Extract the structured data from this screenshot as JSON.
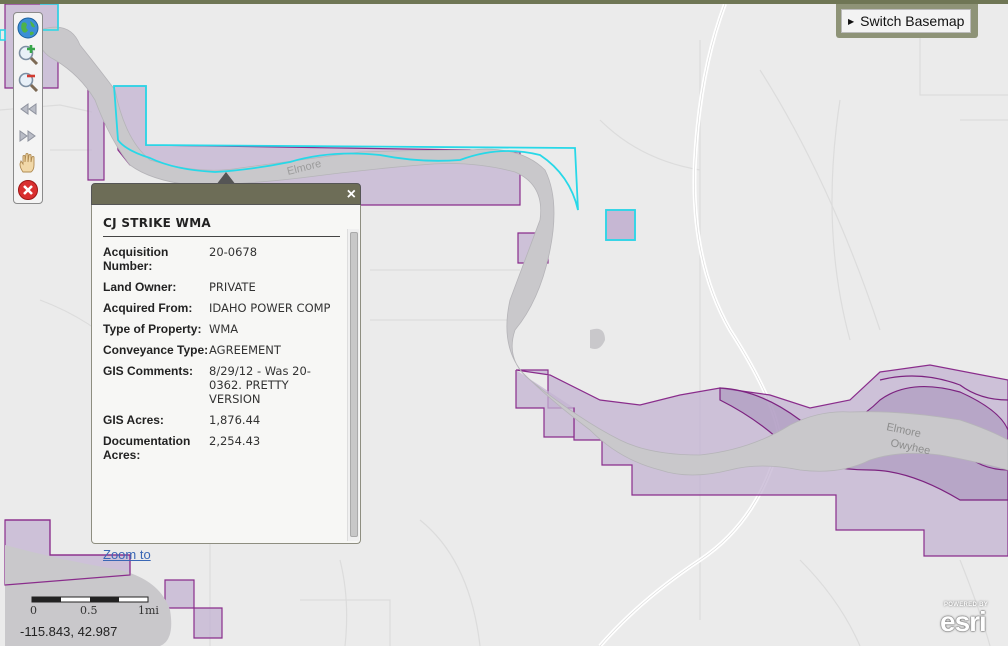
{
  "basemap": {
    "label": "Switch Basemap"
  },
  "toolbar": {
    "tools": [
      "globe-icon",
      "zoom-in-icon",
      "zoom-out-icon",
      "previous-extent-icon",
      "next-extent-icon",
      "pan-hand-icon",
      "close-tools-icon"
    ]
  },
  "map_labels": {
    "upper_river": "Elmore",
    "lower_river": "Elmore\nOwyhee"
  },
  "popup": {
    "close": "×",
    "title": "CJ STRIKE WMA",
    "rows": [
      {
        "label": "Acquisition Number:",
        "value": "20-0678"
      },
      {
        "label": "Land Owner:",
        "value": "PRIVATE"
      },
      {
        "label": "Acquired From:",
        "value": "IDAHO POWER COMP"
      },
      {
        "label": "Type of Property:",
        "value": "WMA"
      },
      {
        "label": "Conveyance Type:",
        "value": "AGREEMENT"
      },
      {
        "label": "GIS Comments:",
        "value": "8/29/12 - Was 20-0362. PRETTY VERSION"
      },
      {
        "label": "GIS Acres:",
        "value": "1,876.44"
      },
      {
        "label": "Documentation Acres:",
        "value": "2,254.43"
      }
    ],
    "zoom_link": "Zoom to"
  },
  "scalebar": {
    "ticks": [
      "0",
      "0.5",
      "1mi"
    ]
  },
  "coordinates": "-115.843, 42.987",
  "attribution": {
    "small": "POWERED BY",
    "big": "esri"
  },
  "colors": {
    "parcel_fill": "#b9a8c8",
    "parcel_stroke": "#8a2d8c",
    "selected_outline": "#27d8e8",
    "water": "#c9c8cb",
    "road": "#ffffff",
    "popup_header": "#6d6d57",
    "basemap_frame": "#8e9377"
  }
}
